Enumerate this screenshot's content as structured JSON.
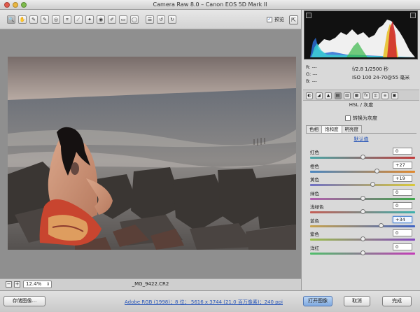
{
  "window": {
    "title": "Camera Raw 8.0 –  Canon EOS 5D Mark II"
  },
  "toolbar": {
    "tools": [
      {
        "name": "zoom-tool-icon",
        "glyph": "🔍"
      },
      {
        "name": "hand-tool-icon",
        "glyph": "✋"
      },
      {
        "name": "white-balance-tool-icon",
        "glyph": "✎"
      },
      {
        "name": "color-sampler-tool-icon",
        "glyph": "✎"
      },
      {
        "name": "targeted-adjustment-tool-icon",
        "glyph": "◎"
      },
      {
        "name": "crop-tool-icon",
        "glyph": "⌗"
      },
      {
        "name": "straighten-tool-icon",
        "glyph": "⟋"
      },
      {
        "name": "spot-removal-tool-icon",
        "glyph": "✦"
      },
      {
        "name": "red-eye-tool-icon",
        "glyph": "◉"
      },
      {
        "name": "adjustment-brush-icon",
        "glyph": "✐"
      },
      {
        "name": "graduated-filter-icon",
        "glyph": "▭"
      },
      {
        "name": "radial-filter-icon",
        "glyph": "◯"
      },
      {
        "name": "preferences-icon",
        "glyph": "☰"
      },
      {
        "name": "rotate-left-icon",
        "glyph": "↺"
      },
      {
        "name": "rotate-right-icon",
        "glyph": "↻"
      }
    ],
    "preview_label": "预览",
    "preview_checked": "✓"
  },
  "canvas": {
    "zoom_out": "−",
    "zoom_in": "+",
    "zoom_value": "12.4%",
    "filename": "_MG_9422.CR2"
  },
  "info": {
    "r_label": "R:",
    "r_value": "---",
    "g_label": "G:",
    "g_value": "---",
    "b_label": "B:",
    "b_value": "---",
    "aperture_shutter": "f/2.8   1/2500 秒",
    "iso_lens": "ISO 100   24-70@55 毫米"
  },
  "panel_tabs": [
    {
      "name": "basic-tab-icon",
      "glyph": "◐"
    },
    {
      "name": "tone-curve-tab-icon",
      "glyph": "◢"
    },
    {
      "name": "detail-tab-icon",
      "glyph": "▲"
    },
    {
      "name": "hsl-tab-icon",
      "glyph": "▤"
    },
    {
      "name": "split-toning-tab-icon",
      "glyph": "▥"
    },
    {
      "name": "lens-corrections-tab-icon",
      "glyph": "▦"
    },
    {
      "name": "effects-tab-icon",
      "glyph": "fx"
    },
    {
      "name": "camera-calibration-tab-icon",
      "glyph": "◫"
    },
    {
      "name": "presets-tab-icon",
      "glyph": "≡"
    },
    {
      "name": "snapshots-tab-icon",
      "glyph": "▣"
    }
  ],
  "hsl": {
    "title": "HSL / 灰度",
    "convert_label": "转换为灰度",
    "subtabs": [
      "色相",
      "饱和度",
      "明亮度"
    ],
    "default_link": "默认值",
    "rows": [
      {
        "label": "红色",
        "value": "0",
        "level": 0,
        "gradient": "linear-gradient(90deg,#4aa7a7,#c23c3c)"
      },
      {
        "label": "橙色",
        "value": "+27",
        "level": 27,
        "gradient": "linear-gradient(90deg,#4a86bf,#e0892e)"
      },
      {
        "label": "黄色",
        "value": "+19",
        "level": 19,
        "gradient": "linear-gradient(90deg,#6f6fc4,#d9c93a)"
      },
      {
        "label": "绿色",
        "value": "0",
        "level": 0,
        "gradient": "linear-gradient(90deg,#b45db0,#3da74a)"
      },
      {
        "label": "浅绿色",
        "value": "0",
        "level": 0,
        "gradient": "linear-gradient(90deg,#c45d55,#3db1ad)"
      },
      {
        "label": "蓝色",
        "value": "+34",
        "level": 34,
        "gradient": "linear-gradient(90deg,#c9a34c,#3f63c4)",
        "focused": true
      },
      {
        "label": "紫色",
        "value": "0",
        "level": 0,
        "gradient": "linear-gradient(90deg,#9bbf4b,#8447be)"
      },
      {
        "label": "洋红",
        "value": "0",
        "level": 0,
        "gradient": "linear-gradient(90deg,#4fbf6a,#c43bb8)"
      }
    ]
  },
  "footer": {
    "save_label": "存储图像...",
    "workflow_link": "Adobe RGB (1998)；8 位；  5616 x 3744 (21.0 百万像素)；240 ppi",
    "open_label": "打开图像",
    "cancel_label": "取消",
    "done_label": "完成"
  }
}
